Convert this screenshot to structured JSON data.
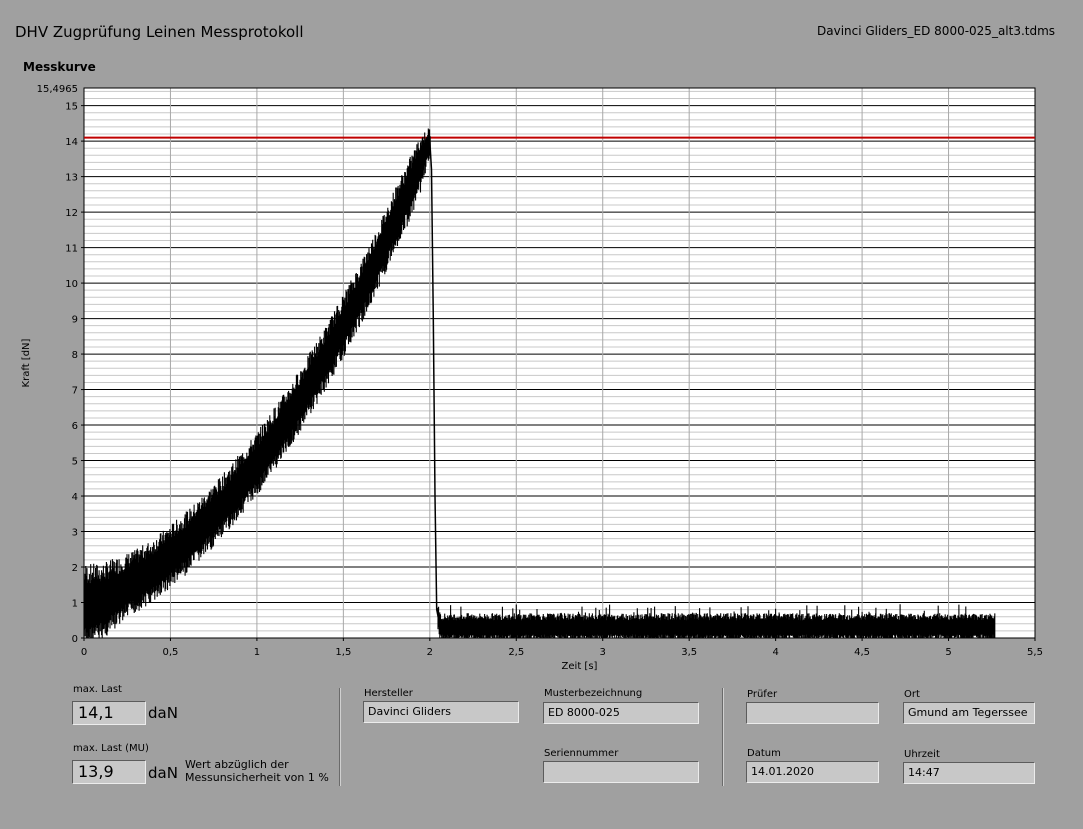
{
  "header": {
    "title": "DHV Zugprüfung Leinen Messprotokoll",
    "filename": "Davinci Gliders_ED 8000-025_alt3.tdms"
  },
  "plot_title": "Messkurve",
  "chart_data": {
    "type": "line",
    "xlabel": "Zeit [s]",
    "ylabel": "Kraft [dN]",
    "xlim": [
      0,
      5.5
    ],
    "ylim": [
      0,
      15.4965
    ],
    "x_ticks": [
      0,
      0.5,
      1,
      1.5,
      2,
      2.5,
      3,
      3.5,
      4,
      4.5,
      5,
      5.5
    ],
    "x_tick_labels": [
      "0",
      "0,5",
      "1",
      "1,5",
      "2",
      "2,5",
      "3",
      "3,5",
      "4",
      "4,5",
      "5",
      "5,5"
    ],
    "y_ticks": [
      0,
      1,
      2,
      3,
      4,
      5,
      6,
      7,
      8,
      9,
      10,
      11,
      12,
      13,
      14,
      15
    ],
    "y_max_label": "15,4965",
    "grid": true,
    "reference_line": {
      "y": 14.1,
      "color": "#c00000"
    },
    "series": [
      {
        "color": "#000000",
        "x": [
          0,
          0.1,
          0.2,
          0.3,
          0.4,
          0.5,
          0.6,
          0.7,
          0.8,
          0.9,
          1.0,
          1.1,
          1.2,
          1.3,
          1.4,
          1.5,
          1.6,
          1.7,
          1.8,
          1.9,
          1.95,
          2.0,
          2.01,
          2.02,
          2.03,
          2.04,
          2.06,
          2.5,
          3.0,
          3.5,
          4.0,
          4.5,
          5.0,
          5.27
        ],
        "y": [
          0.9,
          1.0,
          1.3,
          1.6,
          1.9,
          2.3,
          2.7,
          3.2,
          3.7,
          4.3,
          4.9,
          5.6,
          6.3,
          7.1,
          7.9,
          8.8,
          9.7,
          10.7,
          11.8,
          12.8,
          13.4,
          14.0,
          13.2,
          9.0,
          4.0,
          0.8,
          0.3,
          0.3,
          0.3,
          0.3,
          0.3,
          0.3,
          0.3,
          0.3
        ],
        "noise_band_daN": [
          [
            0.0,
            1.2
          ],
          [
            0.1,
            1.1
          ],
          [
            0.2,
            1.0
          ],
          [
            0.3,
            0.9
          ],
          [
            0.4,
            0.9
          ],
          [
            0.5,
            0.9
          ],
          [
            0.6,
            0.9
          ],
          [
            0.7,
            0.9
          ],
          [
            0.8,
            0.9
          ],
          [
            0.9,
            0.9
          ],
          [
            1.0,
            0.9
          ],
          [
            1.1,
            0.9
          ],
          [
            1.2,
            0.9
          ],
          [
            1.3,
            0.9
          ],
          [
            1.4,
            0.9
          ],
          [
            1.5,
            0.9
          ],
          [
            1.6,
            0.9
          ],
          [
            1.7,
            0.9
          ],
          [
            1.8,
            0.9
          ],
          [
            1.9,
            0.9
          ],
          [
            1.95,
            0.8
          ],
          [
            2.0,
            0.4
          ],
          [
            2.06,
            0.4
          ],
          [
            5.27,
            0.4
          ]
        ]
      }
    ]
  },
  "fields": {
    "max_last": {
      "label": "max. Last",
      "value": "14,1",
      "unit": "daN"
    },
    "max_last_mu": {
      "label": "max. Last (MU)",
      "value": "13,9",
      "unit": "daN",
      "note_line1": "Wert abzüglich der",
      "note_line2": "Messunsicherheit von 1 %"
    },
    "hersteller": {
      "label": "Hersteller",
      "value": "Davinci Gliders"
    },
    "musterbezeichnung": {
      "label": "Musterbezeichnung",
      "value": "ED 8000-025"
    },
    "seriennummer": {
      "label": "Seriennummer",
      "value": ""
    },
    "pruefer": {
      "label": "Prüfer",
      "value": ""
    },
    "ort": {
      "label": "Ort",
      "value": "Gmund am Tegerssee"
    },
    "datum": {
      "label": "Datum",
      "value": "14.01.2020"
    },
    "uhrzeit": {
      "label": "Uhrzeit",
      "value": "14:47"
    }
  }
}
